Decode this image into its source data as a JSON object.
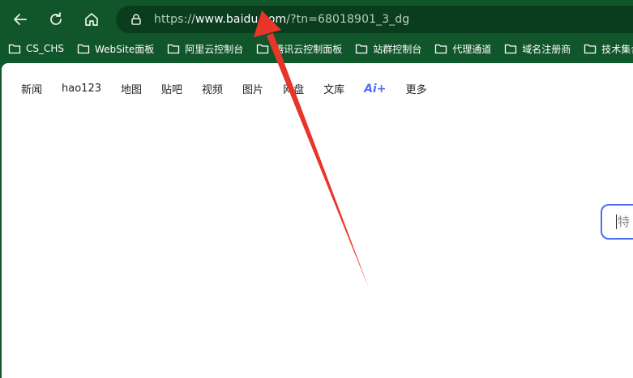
{
  "browser": {
    "url_scheme": "https://",
    "url_host": "www.baidu.com",
    "url_path": "/?tn=68018901_3_dg"
  },
  "bookmarks": [
    {
      "label": "CS_CHS"
    },
    {
      "label": "WebSite面板"
    },
    {
      "label": "阿里云控制台"
    },
    {
      "label": "腾讯云控制面板"
    },
    {
      "label": "站群控制台"
    },
    {
      "label": "代理通道"
    },
    {
      "label": "域名注册商"
    },
    {
      "label": "技术集合"
    }
  ],
  "page": {
    "nav": [
      "新闻",
      "hao123",
      "地图",
      "贴吧",
      "视频",
      "图片",
      "网盘",
      "文库"
    ],
    "ai_label": "Ai+",
    "more_label": "更多",
    "search_placeholder": "特"
  },
  "colors": {
    "browser_chrome": "#11552b",
    "address_bar": "#0a3d1e",
    "accent": "#4e6ef2",
    "annotation_arrow": "#e8352a"
  }
}
